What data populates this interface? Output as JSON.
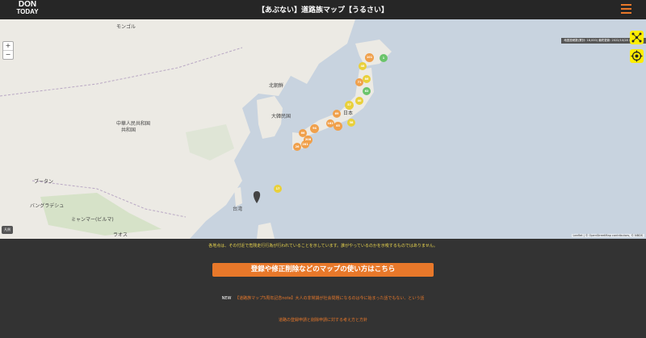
{
  "header": {
    "logo_line1": "DON",
    "logo_line2": "TODAY",
    "title": "【あぶない】道路族マップ【うるさい】"
  },
  "map": {
    "zoom_in": "+",
    "zoom_out": "−",
    "updated_text": "地図投稿数(累計: 18,000)  最終更新: 2022/10/28 16:43 更新",
    "scale_button": "凡例",
    "attribution": "Leaflet | © OpenStreetMap contributors, © NBDS",
    "labels": {
      "mongolia": "モンゴル",
      "china": "中華人民共和国",
      "china2": "共和国",
      "korea": "大韓民国",
      "nkorea": "北朝鮮",
      "japan": "日本",
      "taiwan": "台湾",
      "bangladesh": "バングラデシュ",
      "myanmar": "ミャンマー(ビルマ)",
      "laos": "ラオス",
      "bhutan": "ブータン"
    },
    "clusters": [
      "101",
      "48",
      "71",
      "86",
      "1",
      "40",
      "62",
      "57",
      "69",
      "38",
      "65",
      "182",
      "94",
      "66",
      "208",
      "281",
      "26",
      "17",
      "221",
      "26"
    ],
    "colors": {
      "orange": "#f0a04b",
      "yellow": "#e9d03a",
      "green": "#6bc46b",
      "land": "#eceae4",
      "water": "#c8d3df"
    }
  },
  "notice": "各地点は、その付近で危険走行行為が行われていることを示しています。誰がやっているのかを示唆するものではありません。",
  "cta_label": "登録や修正削除などのマップの使い方はこちら",
  "news": {
    "tag": "NEW",
    "link_text": "【道路族マップ5周年記念note】大人の非常識が社会問題になるのは今に始まった話でもない、という話"
  },
  "guide_link": "道路の登録申請と削除申請に対する考え方と方針"
}
